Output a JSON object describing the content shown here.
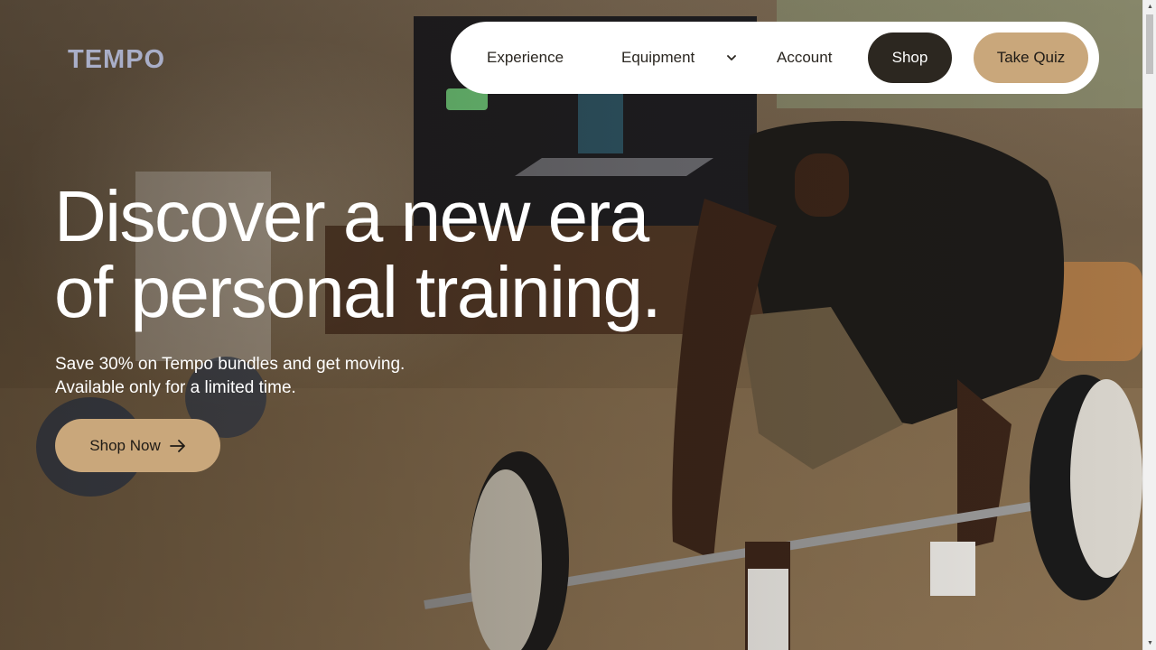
{
  "brand": {
    "logo_text": "TEMPO"
  },
  "nav": {
    "experience": "Experience",
    "equipment": "Equipment",
    "account": "Account",
    "shop": "Shop",
    "take_quiz": "Take Quiz"
  },
  "hero": {
    "headline_line1": "Discover a new era",
    "headline_line2": "of personal training.",
    "sub_line1": "Save 30% on Tempo bundles and get moving.",
    "sub_line2": "Available only for a limited time.",
    "cta_label": "Shop Now"
  },
  "icons": {
    "equipment_dropdown": "chevron-down-icon",
    "cta_arrow": "arrow-right-icon"
  },
  "colors": {
    "logo": "#a9aec8",
    "shop_button": "#2c2720",
    "accent": "#c9a77b",
    "nav_bg": "#ffffff"
  }
}
